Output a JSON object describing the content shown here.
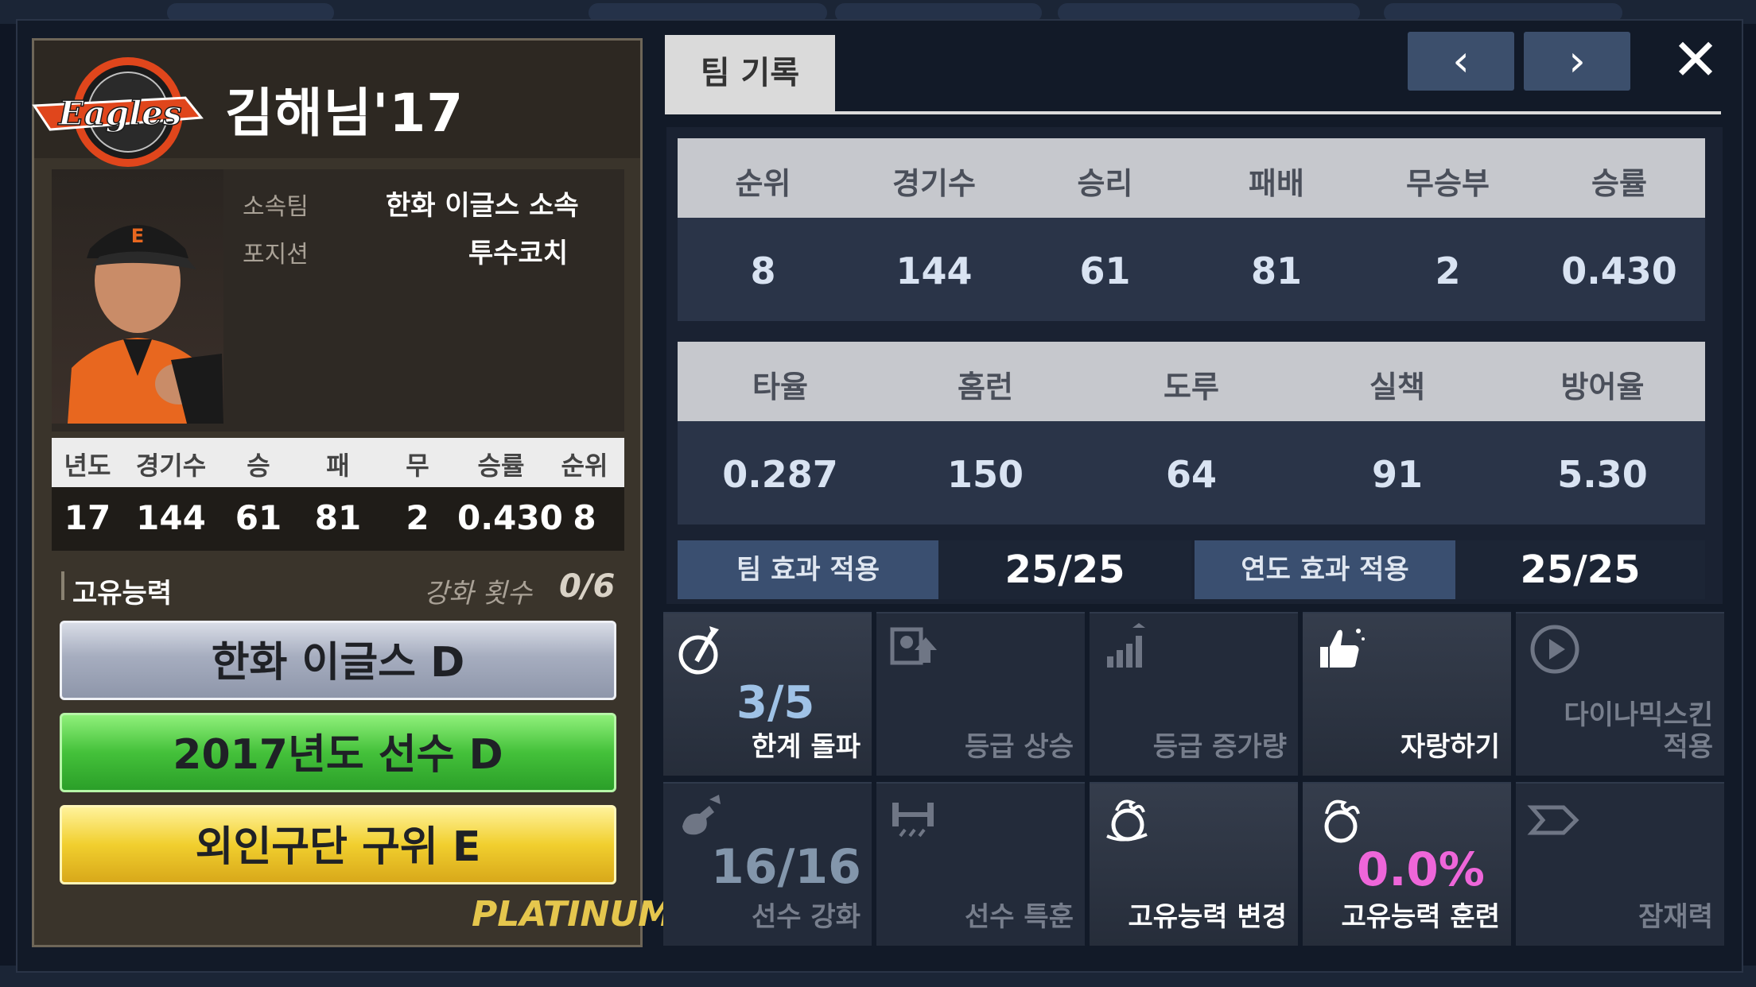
{
  "player": {
    "name": "김해님'17",
    "team_label": "소속팀",
    "team_value": "한화 이글스 소속",
    "position_label": "포지션",
    "position_value": "투수코치",
    "logo_text": "Eagles"
  },
  "season_table": {
    "headers": [
      "년도",
      "경기수",
      "승",
      "패",
      "무",
      "승률",
      "순위"
    ],
    "values": [
      "17",
      "144",
      "61",
      "81",
      "2",
      "0.430",
      "8"
    ]
  },
  "abilities": {
    "title": "고유능력",
    "enhance_label": "강화 횟수",
    "enhance_value": "0/6",
    "items": [
      "한화 이글스 D",
      "2017년도 선수 D",
      "외인구단 구위 E"
    ],
    "grade": "PLATINUM"
  },
  "tab": {
    "label": "팀 기록"
  },
  "nav": {
    "prev": "‹",
    "next": "›",
    "close": "✕"
  },
  "team_record": {
    "headers": [
      "순위",
      "경기수",
      "승리",
      "패배",
      "무승부",
      "승률"
    ],
    "values": [
      "8",
      "144",
      "61",
      "81",
      "2",
      "0.430"
    ]
  },
  "team_stats": {
    "headers": [
      "타율",
      "홈런",
      "도루",
      "실책",
      "방어율"
    ],
    "values": [
      "0.287",
      "150",
      "64",
      "91",
      "5.30"
    ]
  },
  "effects": {
    "team_label": "팀 효과 적용",
    "team_value": "25/25",
    "year_label": "연도 효과 적용",
    "year_value": "25/25"
  },
  "menu": {
    "breakthrough": {
      "label": "한계 돌파",
      "count": "3/5"
    },
    "grade_up": {
      "label": "등급 상승"
    },
    "grade_increase": {
      "label": "등급 증가량"
    },
    "boast": {
      "label": "자랑하기"
    },
    "dynamic_skin": {
      "label_line1": "다이나믹스킨",
      "label_line2": "적용"
    },
    "enhance": {
      "label": "선수 강화",
      "count": "16/16"
    },
    "special_training": {
      "label": "선수 특훈"
    },
    "ability_change": {
      "label": "고유능력 변경"
    },
    "ability_training": {
      "label": "고유능력 훈련",
      "count": "0.0%"
    },
    "potential": {
      "label": "잠재력"
    }
  }
}
